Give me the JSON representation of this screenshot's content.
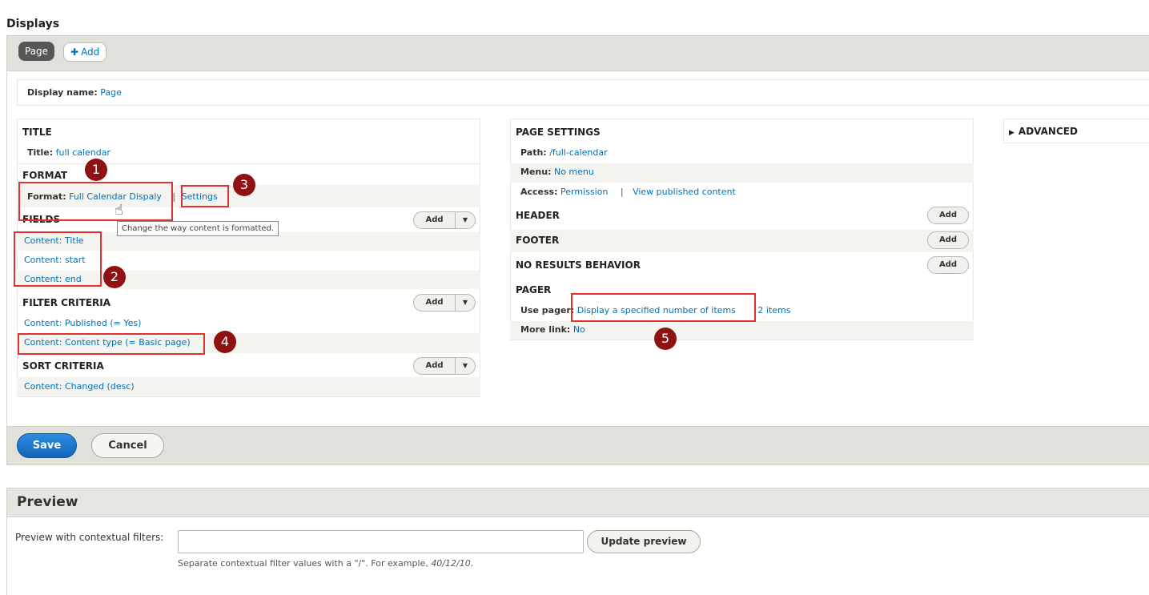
{
  "header": {
    "title": "Displays"
  },
  "tabs": {
    "page": "Page",
    "add": "Add"
  },
  "display_name": {
    "label": "Display name:",
    "value": "Page"
  },
  "left": {
    "title": {
      "heading": "TITLE",
      "label": "Title:",
      "value": "full calendar"
    },
    "format": {
      "heading": "FORMAT",
      "label": "Format:",
      "value": "Full Calendar Dispaly",
      "separator": "|",
      "settings": "Settings",
      "tooltip": "Change the way content is formatted."
    },
    "fields": {
      "heading": "FIELDS",
      "add": "Add",
      "items": [
        "Content: Title",
        "Content: start",
        "Content: end"
      ]
    },
    "filter": {
      "heading": "FILTER CRITERIA",
      "add": "Add",
      "items": [
        "Content: Published (= Yes)",
        "Content: Content type (= Basic page)"
      ]
    },
    "sort": {
      "heading": "SORT CRITERIA",
      "add": "Add",
      "items": [
        "Content: Changed (desc)"
      ]
    }
  },
  "middle": {
    "page_settings": {
      "heading": "PAGE SETTINGS",
      "path_label": "Path:",
      "path_value": "/full-calendar",
      "menu_label": "Menu:",
      "menu_value": "No menu",
      "access_label": "Access:",
      "access_value": "Permission",
      "access_sep": "|",
      "access_value2": "View published content"
    },
    "header": {
      "heading": "HEADER",
      "add": "Add"
    },
    "footer": {
      "heading": "FOOTER",
      "add": "Add"
    },
    "no_results": {
      "heading": "NO RESULTS BEHAVIOR",
      "add": "Add"
    },
    "pager": {
      "heading": "PAGER",
      "use_pager_label": "Use pager:",
      "use_pager_value": "Display a specified number of items",
      "items_value": "2 items",
      "more_link_label": "More link:",
      "more_link_value": "No"
    }
  },
  "right": {
    "advanced": "ADVANCED",
    "arrow": "▶"
  },
  "markers": [
    "1",
    "2",
    "3",
    "4",
    "5"
  ],
  "actions": {
    "save": "Save",
    "cancel": "Cancel"
  },
  "preview": {
    "title": "Preview",
    "label": "Preview with contextual filters:",
    "input_value": "",
    "button": "Update preview",
    "help_prefix": "Separate contextual filter values with a \"/\". For example, ",
    "help_example": "40/12/10",
    "help_suffix": "."
  }
}
